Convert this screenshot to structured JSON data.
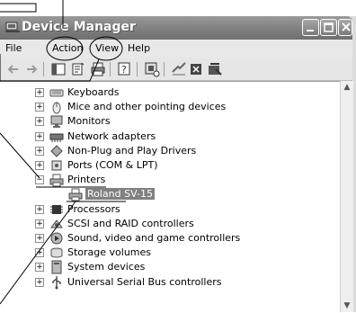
{
  "window": {
    "title": "Device Manager"
  },
  "menu": [
    {
      "label": "File"
    },
    {
      "label": "Action"
    },
    {
      "label": "View"
    },
    {
      "label": "Help"
    }
  ],
  "tree": [
    {
      "label": "Keyboards",
      "icon": "keyboard-icon"
    },
    {
      "label": "Mice and other pointing devices",
      "icon": "mouse-icon"
    },
    {
      "label": "Monitors",
      "icon": "monitor-icon"
    },
    {
      "label": "Network adapters",
      "icon": "network-adapter-icon"
    },
    {
      "label": "Non-Plug and Play Drivers",
      "icon": "driver-icon"
    },
    {
      "label": "Ports (COM & LPT)",
      "icon": "port-icon"
    },
    {
      "label": "Printers",
      "icon": "printer-icon"
    },
    {
      "label": "Roland SV-15",
      "icon": "printer-icon"
    },
    {
      "label": "Processors",
      "icon": "processor-icon"
    },
    {
      "label": "SCSI and RAID controllers",
      "icon": "scsi-icon"
    },
    {
      "label": "Sound, video and game controllers",
      "icon": "sound-icon"
    },
    {
      "label": "Storage volumes",
      "icon": "storage-icon"
    },
    {
      "label": "System devices",
      "icon": "system-icon"
    },
    {
      "label": "Universal Serial Bus controllers",
      "icon": "usb-icon"
    }
  ]
}
